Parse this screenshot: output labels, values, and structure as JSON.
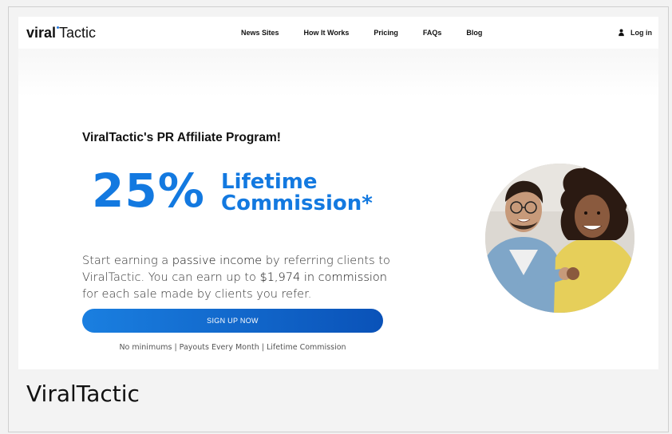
{
  "header": {
    "logo_bold": "viral",
    "logo_light": "Tactic",
    "nav": [
      "News Sites",
      "How It Works",
      "Pricing",
      "FAQs",
      "Blog"
    ],
    "login_label": "Log in"
  },
  "hero": {
    "title": "ViralTactic's PR Affiliate Program!",
    "percent": "25%",
    "lifetime_line1": "Lifetime",
    "lifetime_line2": "Commission*",
    "desc": {
      "p1": "Start earning a ",
      "em1": "passive income",
      "p2": " by referring clients to ViralTactic. You can earn up to ",
      "em2": "$1,974 in commission",
      "p3": " for each sale made by clients you refer."
    },
    "cta_label": "SIGN UP NOW",
    "perks": "No minimums |  Payouts Every Month | Lifetime Commission"
  },
  "caption": "ViralTactic",
  "colors": {
    "accent": "#1379e0",
    "cta_start": "#1a7fe0",
    "cta_end": "#0a52b8"
  }
}
